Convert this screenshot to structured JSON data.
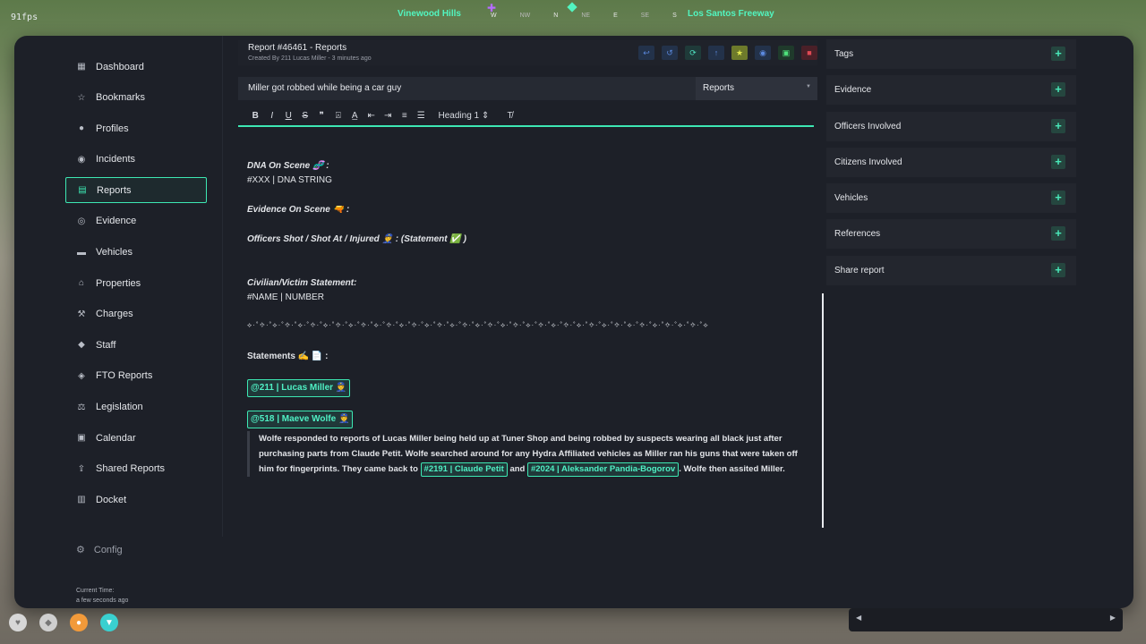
{
  "hud": {
    "fps": "91fps",
    "street_left": "Vinewood Hills",
    "street_right": "Los Santos Freeway",
    "compass": [
      "W",
      "NW",
      "N",
      "NE",
      "E",
      "SE",
      "S"
    ]
  },
  "sidebar": {
    "items": [
      {
        "label": "Dashboard",
        "icon": "dashboard-icon"
      },
      {
        "label": "Bookmarks",
        "icon": "star-icon"
      },
      {
        "label": "Profiles",
        "icon": "user-icon"
      },
      {
        "label": "Incidents",
        "icon": "person-alert-icon"
      },
      {
        "label": "Reports",
        "icon": "document-icon",
        "active": true
      },
      {
        "label": "Evidence",
        "icon": "fingerprint-icon"
      },
      {
        "label": "Vehicles",
        "icon": "car-icon"
      },
      {
        "label": "Properties",
        "icon": "house-icon"
      },
      {
        "label": "Charges",
        "icon": "gavel-icon"
      },
      {
        "label": "Staff",
        "icon": "shield-icon"
      },
      {
        "label": "FTO Reports",
        "icon": "shield-star-icon"
      },
      {
        "label": "Legislation",
        "icon": "scale-icon"
      },
      {
        "label": "Calendar",
        "icon": "calendar-icon"
      },
      {
        "label": "Shared Reports",
        "icon": "share-icon"
      },
      {
        "label": "Docket",
        "icon": "docket-icon"
      }
    ],
    "config_label": "Config",
    "current_time_label": "Current Time:",
    "current_time_value": "a few seconds ago"
  },
  "report": {
    "title": "Report #46461 - Reports",
    "subtitle": "Created By 211 Lucas Miller - 3 minutes ago",
    "name_value": "Miller got robbed while being a car guy",
    "type_value": "Reports",
    "heading_select": "Heading 1",
    "content": {
      "dna_heading": "DNA On Scene 🧬 :",
      "dna_value": "#XXX | DNA STRING",
      "evidence_heading": "Evidence On Scene 🔫 :",
      "officers_heading": "Officers Shot / Shot At / Injured 👮 : (Statement ✅ )",
      "statement_heading": "Civilian/Victim Statement:",
      "statement_value": "#NAME | NUMBER",
      "separator": "⟡·˚✧·˚⟡·˚✧·˚⟡·˚✧·˚⟡·˚✧·˚⟡·˚✧·˚⟡·˚✧·˚⟡·˚✧·˚⟡·˚✧·˚⟡·˚✧·˚⟡·˚✧·˚⟡·˚✧·˚⟡·˚✧·˚⟡·˚✧·˚⟡·˚✧·˚⟡·˚✧·˚⟡·˚✧·˚⟡·˚✧·˚⟡·˚✧·˚⟡",
      "statements_heading": "Statements ✍️ 📄 :",
      "mention_1": "@211 | Lucas Miller 👮",
      "mention_2": "@518 | Maeve Wolfe 👮",
      "quote_part_1": "Wolfe responded to reports of Lucas Miller being held up at Tuner Shop and being robbed by suspects wearing all black just after purchasing parts from Claude Petit. Wolfe searched around for any Hydra Affiliated vehicles as Miller ran his guns that were taken off him for fingerprints. They came back to ",
      "quote_mention_1": "#2191 | Claude Petit",
      "quote_and": " and ",
      "quote_mention_2": "#2024 | Aleksander Pandia-Bogorov",
      "quote_part_2": ". Wolfe then assited Miller."
    }
  },
  "right_sections": [
    "Tags",
    "Evidence",
    "Officers Involved",
    "Citizens Involved",
    "Vehicles",
    "References",
    "Share report"
  ],
  "colors": {
    "accent": "#3de8b3",
    "panel_bg": "#1d2028"
  }
}
